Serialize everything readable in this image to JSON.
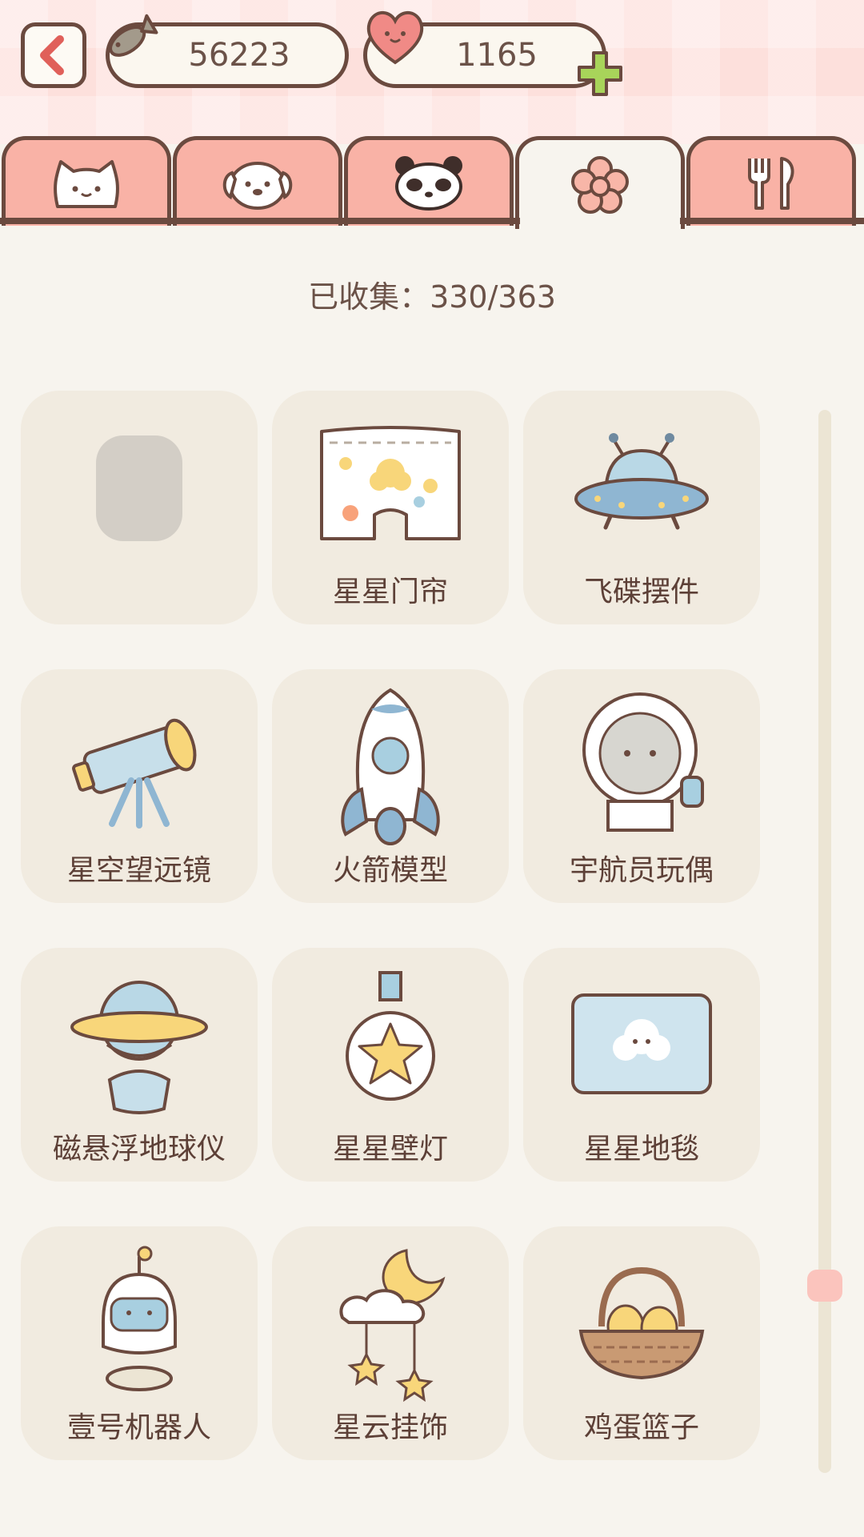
{
  "currency": {
    "fish_amount": "56223",
    "heart_amount": "1165"
  },
  "tabs": [
    {
      "icon": "cat-face-icon",
      "active": false
    },
    {
      "icon": "dog-face-icon",
      "active": false
    },
    {
      "icon": "panda-face-icon",
      "active": false
    },
    {
      "icon": "flower-icon",
      "active": true
    },
    {
      "icon": "fork-spoon-icon",
      "active": false
    }
  ],
  "collection": {
    "collected_text": "已收集：330/363"
  },
  "items": [
    {
      "label": "",
      "icon": "locked-silhouette"
    },
    {
      "label": "星星门帘",
      "icon": "star-curtain"
    },
    {
      "label": "飞碟摆件",
      "icon": "ufo-ornament"
    },
    {
      "label": "星空望远镜",
      "icon": "telescope"
    },
    {
      "label": "火箭模型",
      "icon": "rocket-model"
    },
    {
      "label": "宇航员玩偶",
      "icon": "astronaut-doll"
    },
    {
      "label": "磁悬浮地球仪",
      "icon": "maglev-globe"
    },
    {
      "label": "星星壁灯",
      "icon": "star-wall-lamp"
    },
    {
      "label": "星星地毯",
      "icon": "star-rug"
    },
    {
      "label": "壹号机器人",
      "icon": "robot-one"
    },
    {
      "label": "星云挂饰",
      "icon": "nebula-mobile"
    },
    {
      "label": "鸡蛋篮子",
      "icon": "egg-basket"
    }
  ],
  "colors": {
    "outline": "#6b4a3f",
    "tab_inactive": "#f9b2a6",
    "card_bg": "#f1ebe0",
    "page_bg": "#f7f4ee",
    "accent_green": "#a8d45a"
  }
}
